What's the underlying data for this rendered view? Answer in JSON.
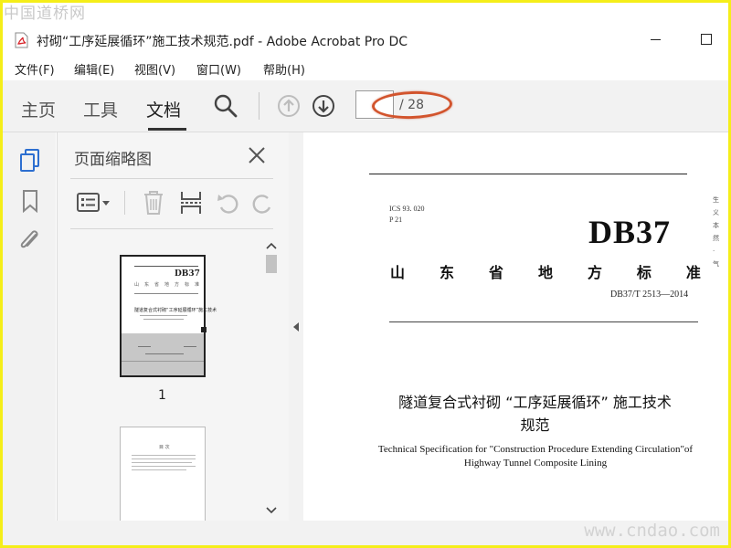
{
  "watermark": {
    "site_cn": "中国道桥网",
    "site_url": "www.cndao.com"
  },
  "window": {
    "title": "衬砌“工序延展循环”施工技术规范.pdf - Adobe Acrobat Pro DC"
  },
  "menu": {
    "items": [
      "文件(F)",
      "编辑(E)",
      "视图(V)",
      "窗口(W)",
      "帮助(H)"
    ]
  },
  "toolbar": {
    "tabs": [
      "主页",
      "工具",
      "文档"
    ],
    "active_tab": "文档",
    "page_input_value": "",
    "page_total": "/ 28"
  },
  "panel": {
    "title": "页面缩略图",
    "thumbnail_1_label": "1",
    "thumb_db": "DB37"
  },
  "document": {
    "ics": "ICS 93. 020",
    "p_code": "P  21",
    "db_code": "DB37",
    "province_chars": [
      "山",
      "东",
      "省",
      "地",
      "方",
      "标",
      "准"
    ],
    "standard_number": "DB37/T  2513—2014",
    "title_cn_line1": "隧道复合式衬砌 “工序延展循环” 施工技术",
    "title_cn_line2": "规范",
    "title_en_line1": "Technical Specification for \"Construction Procedure Extending Circulation\"of",
    "title_en_line2": "Highway Tunnel Composite Lining",
    "side_chars": [
      "生",
      "义",
      "本",
      "然",
      "·",
      "气"
    ]
  },
  "colors": {
    "frame": "#f5ee19",
    "annotation_ellipse": "#d2542d",
    "toolbar_bg": "#f2f2f2",
    "pdf_red": "#d8272d",
    "icon_blue": "#2d6fd0"
  }
}
